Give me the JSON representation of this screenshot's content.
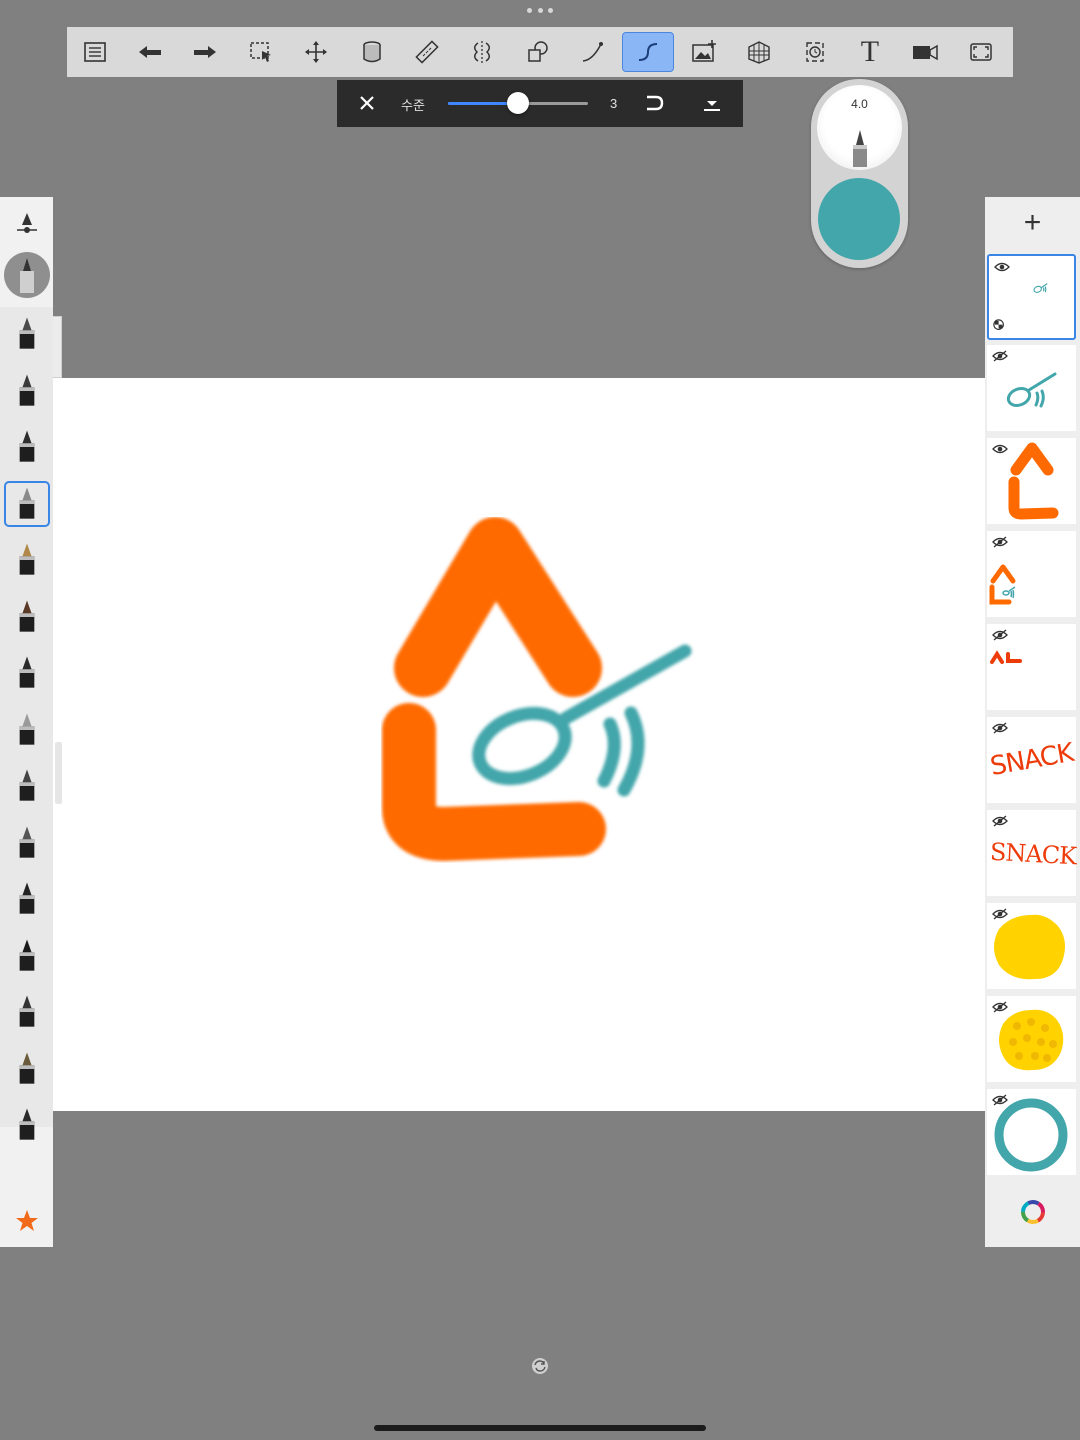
{
  "toolbar": {
    "buttons": [
      {
        "icon": "list-icon"
      },
      {
        "icon": "undo-icon"
      },
      {
        "icon": "redo-icon"
      },
      {
        "icon": "selection-icon"
      },
      {
        "icon": "transform-icon"
      },
      {
        "icon": "fill-icon"
      },
      {
        "icon": "ruler-icon"
      },
      {
        "icon": "symmetry-icon"
      },
      {
        "icon": "shape-icon"
      },
      {
        "icon": "curve-icon"
      },
      {
        "icon": "stroke-predict-icon",
        "active": true
      },
      {
        "icon": "add-image-icon"
      },
      {
        "icon": "perspective-grid-icon"
      },
      {
        "icon": "timelapse-icon"
      },
      {
        "icon": "text-icon",
        "glyph": "T"
      },
      {
        "icon": "video-icon"
      },
      {
        "icon": "fullscreen-icon"
      }
    ]
  },
  "subbar": {
    "label": "수준",
    "level_value": "3",
    "level_fraction": 0.5
  },
  "puck": {
    "size_label": "4.0",
    "color": "#42a6aa"
  },
  "brushes": {
    "items": [
      "ruler-brush-icon",
      "pencil-icon",
      "marker-icon",
      "ink-pen-icon",
      "ballpoint-pen-icon",
      "fountain-pen-icon",
      "paint-brush-icon",
      "round-brush-icon",
      "airbrush-icon",
      "chisel-marker-icon",
      "wide-marker-icon",
      "eraser-icon",
      "blender-icon",
      "smudge-icon",
      "texture-brush-icon",
      "flat-brush-icon"
    ],
    "selected_index": 3,
    "favorites_icon": "star-icon"
  },
  "colors": {
    "orange": "#ff6a00",
    "teal": "#42a6aa",
    "yellow": "#ffd200",
    "accent": "#3a86e6"
  },
  "layers": {
    "add_label": "+",
    "items": [
      {
        "name": "layer-1",
        "visible": true,
        "selected": true
      },
      {
        "name": "layer-2",
        "visible": true
      },
      {
        "name": "layer-3",
        "visible": true
      },
      {
        "name": "layer-4",
        "visible": false
      },
      {
        "name": "layer-5",
        "visible": false
      },
      {
        "name": "layer-6",
        "visible": false,
        "text": "SNACK"
      },
      {
        "name": "layer-7",
        "visible": false,
        "text": "SNACK"
      },
      {
        "name": "layer-8",
        "visible": false
      },
      {
        "name": "layer-9",
        "visible": false
      },
      {
        "name": "layer-10",
        "visible": false
      }
    ]
  }
}
